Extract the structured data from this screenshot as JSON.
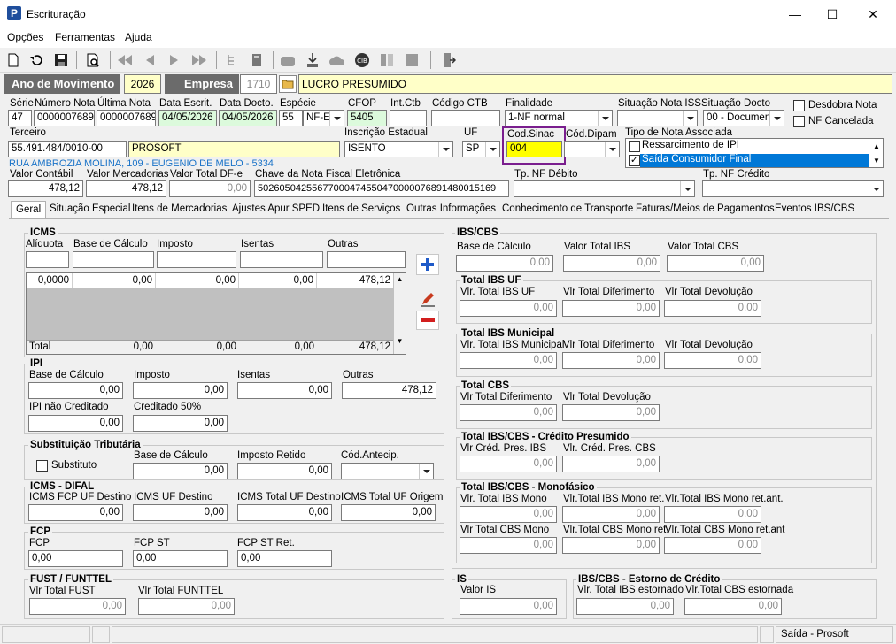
{
  "window": {
    "title": "Escrituração",
    "minimize": "—",
    "maximize": "☐",
    "close": "✕"
  },
  "menu": [
    "Opções",
    "Ferramentas",
    "Ajuda"
  ],
  "header": {
    "ano_label": "Ano de Movimento",
    "ano_value": "2026",
    "empresa_label": "Empresa",
    "empresa_code": "1710",
    "empresa_name": "LUCRO PRESUMIDO"
  },
  "row1": {
    "serie": {
      "label": "Série",
      "value": "47"
    },
    "numero_nota": {
      "label": "Número Nota",
      "value": "0000007689"
    },
    "ultima_nota": {
      "label": "Última Nota",
      "value": "0000007689"
    },
    "data_escrit": {
      "label": "Data Escrit.",
      "value": "04/05/2026"
    },
    "data_docto": {
      "label": "Data Docto.",
      "value": "04/05/2026"
    },
    "especie": {
      "label": "Espécie",
      "code": "55",
      "value": "NF-E"
    },
    "cfop": {
      "label": "CFOP",
      "value": "5405"
    },
    "int_ctb": {
      "label": "Int.Ctb",
      "value": ""
    },
    "codigo_ctb": {
      "label": "Código CTB",
      "value": ""
    },
    "finalidade": {
      "label": "Finalidade",
      "value": "1-NF normal"
    },
    "situacao_iss": {
      "label": "Situação Nota ISS",
      "value": ""
    },
    "situacao_docto": {
      "label": "Situação Docto",
      "value": "00 - Document"
    },
    "desdobra_nota": "Desdobra Nota",
    "nf_cancelada": "NF Cancelada"
  },
  "row2": {
    "terceiro": {
      "label": "Terceiro",
      "code": "55.491.484/0010-00",
      "name": "PROSOFT"
    },
    "endereco": "RUA AMBROZIA MOLINA, 109 - EUGENIO DE MELO - 5334",
    "inscricao_estadual": {
      "label": "Inscrição Estadual",
      "value": "ISENTO"
    },
    "uf": {
      "label": "UF",
      "value": "SP"
    },
    "cod_sinac": {
      "label": "Cod.Sinac",
      "value": "004"
    },
    "cod_dipam": {
      "label": "Cód.Dipam",
      "value": ""
    },
    "tipo_nota": {
      "label": "Tipo de Nota Associada",
      "items": [
        {
          "label": "Ressarcimento de IPI",
          "checked": false
        },
        {
          "label": "Saída Consumidor Final",
          "checked": true
        }
      ]
    }
  },
  "row3": {
    "valor_contabil": {
      "label": "Valor Contábil",
      "value": "478,12"
    },
    "valor_mercadorias": {
      "label": "Valor Mercadorias",
      "value": "478,12"
    },
    "valor_total_dfe": {
      "label": "Valor Total DF-e",
      "value": "0,00"
    },
    "chave": {
      "label": "Chave da Nota Fiscal Eletrônica",
      "value": "50260504255677000474550470000076891480015169"
    },
    "tp_nf_debito": {
      "label": "Tp. NF Débito",
      "value": ""
    },
    "tp_nf_credito": {
      "label": "Tp. NF Crédito",
      "value": ""
    }
  },
  "tabs": [
    "Geral",
    "Situação Especial",
    "Itens de Mercadorias",
    "Ajustes Apur SPED",
    "Itens de Serviços",
    "Outras Informações",
    "Conhecimento de Transporte",
    "Faturas/Meios de Pagamentos",
    "Eventos IBS/CBS"
  ],
  "icms": {
    "title": "ICMS",
    "columns": [
      "Alíquota",
      "Base de Cálculo",
      "Imposto",
      "Isentas",
      "Outras"
    ],
    "row": [
      "0,0000",
      "0,00",
      "0,00",
      "0,00",
      "478,12"
    ],
    "total_label": "Total",
    "total": [
      "0,00",
      "0,00",
      "0,00",
      "478,12"
    ]
  },
  "ipi": {
    "title": "IPI",
    "base": {
      "label": "Base de Cálculo",
      "value": "0,00"
    },
    "imposto": {
      "label": "Imposto",
      "value": "0,00"
    },
    "isentas": {
      "label": "Isentas",
      "value": "0,00"
    },
    "outras": {
      "label": "Outras",
      "value": "478,12"
    },
    "nao_creditado": {
      "label": "IPI não Creditado",
      "value": "0,00"
    },
    "creditado50": {
      "label": "Creditado 50%",
      "value": "0,00"
    }
  },
  "st": {
    "title": "Substituição Tributária",
    "substituto": "Substituto",
    "base": {
      "label": "Base de Cálculo",
      "value": "0,00"
    },
    "retido": {
      "label": "Imposto Retido",
      "value": "0,00"
    },
    "cod_antecip": {
      "label": "Cód.Antecip.",
      "value": ""
    }
  },
  "difal": {
    "title": "ICMS - DIFAL",
    "fcp_uf": {
      "label": "ICMS FCP UF Destino",
      "value": "0,00"
    },
    "uf_destino": {
      "label": "ICMS UF Destino",
      "value": "0,00"
    },
    "total_destino": {
      "label": "ICMS Total UF Destino",
      "value": "0,00"
    },
    "total_origem": {
      "label": "ICMS Total UF Origem",
      "value": "0,00"
    }
  },
  "fcp": {
    "title": "FCP",
    "fcp": {
      "label": "FCP",
      "value": "0,00"
    },
    "fcp_st": {
      "label": "FCP ST",
      "value": "0,00"
    },
    "fcp_st_ret": {
      "label": "FCP ST Ret.",
      "value": "0,00"
    }
  },
  "fust": {
    "title": "FUST / FUNTTEL",
    "fust": {
      "label": "Vlr Total FUST",
      "value": "0,00"
    },
    "funttel": {
      "label": "Vlr Total FUNTTEL",
      "value": "0,00"
    }
  },
  "ibscbs": {
    "title": "IBS/CBS",
    "base": {
      "label": "Base de Cálculo",
      "value": "0,00"
    },
    "total_ibs": {
      "label": "Valor Total IBS",
      "value": "0,00"
    },
    "total_cbs": {
      "label": "Valor Total CBS",
      "value": "0,00"
    },
    "uf": {
      "title": "Total IBS UF",
      "fields": [
        {
          "label": "Vlr. Total IBS UF",
          "value": "0,00"
        },
        {
          "label": "Vlr Total Diferimento",
          "value": "0,00"
        },
        {
          "label": "Vlr Total Devolução",
          "value": "0,00"
        }
      ]
    },
    "mun": {
      "title": "Total IBS Municipal",
      "fields": [
        {
          "label": "Vlr. Total IBS Municipal",
          "value": "0,00"
        },
        {
          "label": "Vlr Total Diferimento",
          "value": "0,00"
        },
        {
          "label": "Vlr Total Devolução",
          "value": "0,00"
        }
      ]
    },
    "cbs": {
      "title": "Total CBS",
      "fields": [
        {
          "label": "Vlr Total Diferimento",
          "value": "0,00"
        },
        {
          "label": "Vlr Total Devolução",
          "value": "0,00"
        }
      ]
    },
    "presumido": {
      "title": "Total IBS/CBS - Crédito Presumido",
      "fields": [
        {
          "label": "Vlr Créd. Pres. IBS",
          "value": "0,00"
        },
        {
          "label": "Vlr. Créd. Pres. CBS",
          "value": "0,00"
        }
      ]
    },
    "mono": {
      "title": "Total IBS/CBS - Monofásico",
      "fields": [
        {
          "label": "Vlr. Total IBS Mono",
          "value": "0,00"
        },
        {
          "label": "Vlr.Total IBS Mono ret.",
          "value": "0,00"
        },
        {
          "label": "Vlr.Total IBS Mono ret.ant.",
          "value": "0,00"
        },
        {
          "label": "Vlr Total CBS Mono",
          "value": "0,00"
        },
        {
          "label": "Vlr.Total CBS Mono ret.",
          "value": "0,00"
        },
        {
          "label": "Vlr.Total CBS Mono ret.ant",
          "value": "0,00"
        }
      ]
    }
  },
  "is": {
    "title": "IS",
    "valor": {
      "label": "Valor IS",
      "value": "0,00"
    }
  },
  "estorno": {
    "title": "IBS/CBS - Estorno de Crédito",
    "ibs": {
      "label": "Vlr. Total IBS estornado",
      "value": "0,00"
    },
    "cbs": {
      "label": "Vlr.Total CBS estornada",
      "value": "0,00"
    }
  },
  "status": {
    "text": "Saída - Prosoft"
  }
}
